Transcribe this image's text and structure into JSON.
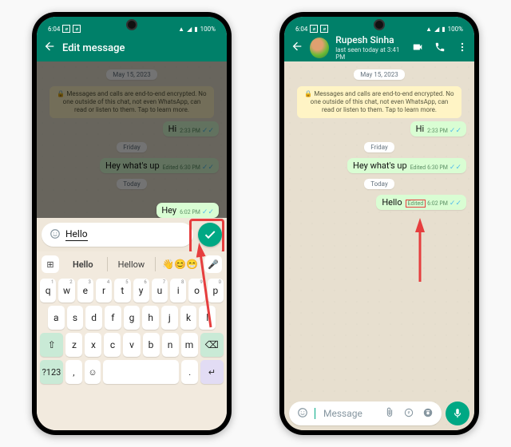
{
  "status": {
    "time": "6:04",
    "battery": "100%"
  },
  "edit_header": {
    "title": "Edit message"
  },
  "chat_header": {
    "name": "Rupesh Sinha",
    "subtitle": "last seen today at 3:41 PM"
  },
  "date_chip": "May 15, 2023",
  "encryption_notice": "🔒 Messages and calls are end-to-end encrypted. No one outside of this chat, not even WhatsApp, can read or listen to them. Tap to learn more.",
  "messages": {
    "m1": {
      "text": "Hi",
      "time": "2:33 PM"
    },
    "day1": "Friday",
    "m2": {
      "text": "Hey what's up",
      "edited": "Edited",
      "time": "6:30 PM"
    },
    "day2": "Today",
    "m3": {
      "text": "Hello",
      "edited": "Edited",
      "time": "6:02 PM"
    },
    "m3_prev": {
      "text": "Hey",
      "time": "6:02 PM"
    }
  },
  "edit_input": "Hello",
  "compose_placeholder": "Message",
  "keyboard": {
    "suggestion1": "Hello",
    "suggestion2": "Hellow",
    "row1": [
      "q",
      "w",
      "e",
      "r",
      "t",
      "y",
      "u",
      "i",
      "o",
      "p"
    ],
    "hint1": [
      "1",
      "2",
      "3",
      "4",
      "5",
      "6",
      "7",
      "8",
      "9",
      "0"
    ],
    "row2": [
      "a",
      "s",
      "d",
      "f",
      "g",
      "h",
      "j",
      "k",
      "l"
    ],
    "row3": [
      "z",
      "x",
      "c",
      "v",
      "b",
      "n",
      "m"
    ],
    "shift": "⇧",
    "backspace": "⌫",
    "numkey": "?123",
    "comma": ",",
    "emoji": "☺",
    "period": ".",
    "enter": "↵"
  }
}
